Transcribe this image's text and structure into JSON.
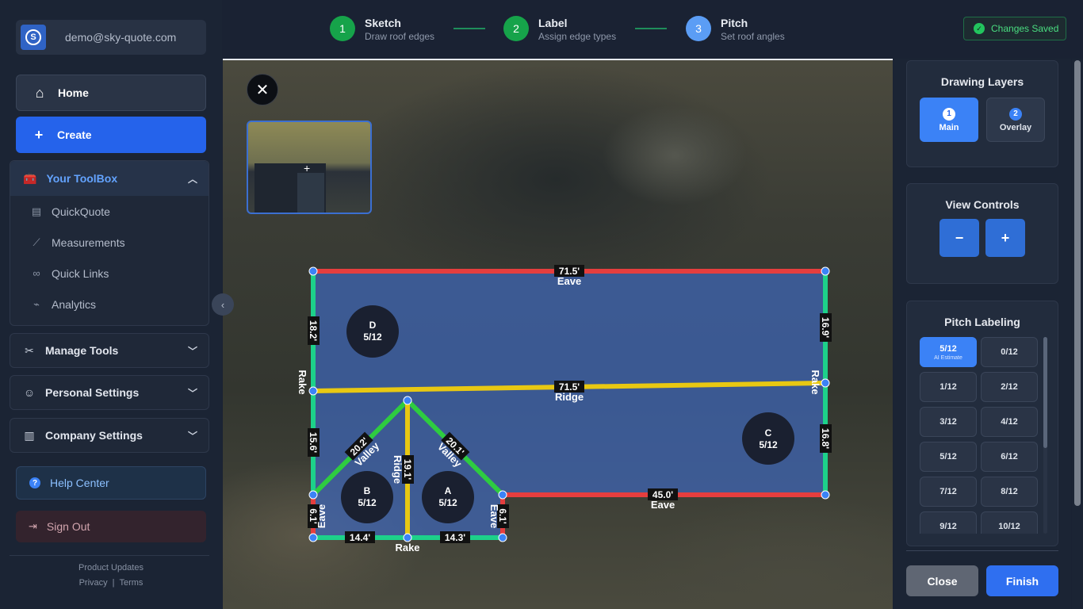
{
  "account": {
    "email": "demo@sky-quote.com",
    "logo_letter": "S"
  },
  "nav": {
    "home": "Home",
    "create": "Create"
  },
  "toolbox": {
    "title": "Your ToolBox",
    "items": [
      {
        "label": "QuickQuote",
        "icon": "document-icon"
      },
      {
        "label": "Measurements",
        "icon": "ruler-icon"
      },
      {
        "label": "Quick Links",
        "icon": "link-icon"
      },
      {
        "label": "Analytics",
        "icon": "chart-icon"
      }
    ]
  },
  "sections": {
    "manage": "Manage Tools",
    "personal": "Personal Settings",
    "company": "Company Settings"
  },
  "help": "Help Center",
  "signout": "Sign Out",
  "footer": {
    "updates": "Product Updates",
    "privacy": "Privacy",
    "separator": "|",
    "terms": "Terms"
  },
  "steps": [
    {
      "num": "1",
      "title": "Sketch",
      "subtitle": "Draw roof edges",
      "state": "done"
    },
    {
      "num": "2",
      "title": "Label",
      "subtitle": "Assign edge types",
      "state": "done"
    },
    {
      "num": "3",
      "title": "Pitch",
      "subtitle": "Set roof angles",
      "state": "active"
    }
  ],
  "saved_status": "Changes Saved",
  "canvas": {
    "close_symbol": "✕",
    "colors": {
      "eave": "#e53e3e",
      "rake": "#1dd18a",
      "ridge": "#e8c812",
      "valley": "#2ecc40",
      "vertex": "#3b82f6",
      "fill": "#3f67b8"
    },
    "edges": [
      {
        "length": "71.5'",
        "type": "Eave"
      },
      {
        "length": "18.2'",
        "type": "Rake"
      },
      {
        "length": "16.9'",
        "type": "Rake"
      },
      {
        "length": "71.5'",
        "type": "Ridge"
      },
      {
        "length": "15.6'",
        "type": ""
      },
      {
        "length": "16.8'",
        "type": ""
      },
      {
        "length": "20.2'",
        "type": "Valley"
      },
      {
        "length": "20.1'",
        "type": "Valley"
      },
      {
        "length": "19.1'",
        "type": "Ridge"
      },
      {
        "length": "45.0'",
        "type": "Eave"
      },
      {
        "length": "6.1'",
        "type": "Eave"
      },
      {
        "length": "6.1'",
        "type": "Eave"
      },
      {
        "length": "14.4'",
        "type": "Rake"
      },
      {
        "length": "14.3'",
        "type": ""
      }
    ],
    "facets": [
      {
        "id": "D",
        "pitch": "5/12"
      },
      {
        "id": "C",
        "pitch": "5/12"
      },
      {
        "id": "B",
        "pitch": "5/12"
      },
      {
        "id": "A",
        "pitch": "5/12"
      }
    ]
  },
  "panel": {
    "layers_title": "Drawing Layers",
    "layers": [
      {
        "num": "1",
        "label": "Main"
      },
      {
        "num": "2",
        "label": "Overlay"
      }
    ],
    "view_title": "View Controls",
    "zoom_out": "−",
    "zoom_in": "+",
    "pitch_title": "Pitch Labeling",
    "pitch_selected_sub": "AI Estimate",
    "pitches": [
      "5/12",
      "0/12",
      "1/12",
      "2/12",
      "3/12",
      "4/12",
      "5/12",
      "6/12",
      "7/12",
      "8/12",
      "9/12",
      "10/12"
    ],
    "close": "Close",
    "finish": "Finish"
  }
}
